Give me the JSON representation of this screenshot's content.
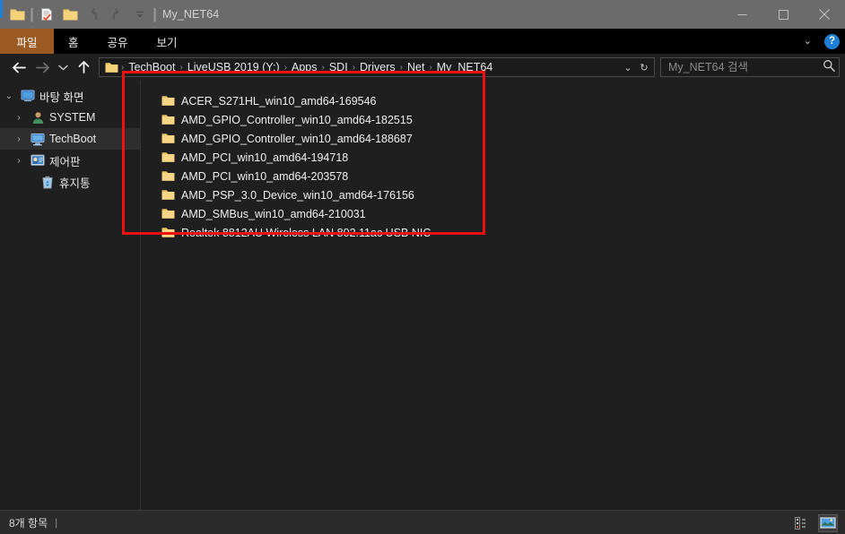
{
  "window": {
    "title": "My_NET64",
    "quick_access": [
      {
        "name": "folder-icon",
        "label": "folder"
      },
      {
        "name": "properties-icon",
        "label": "properties"
      },
      {
        "name": "new-folder-icon",
        "label": "new folder"
      },
      {
        "name": "undo-icon",
        "label": "undo"
      },
      {
        "name": "redo-icon",
        "label": "redo"
      },
      {
        "name": "customize-qat-icon",
        "label": "customize"
      }
    ],
    "controls": {
      "minimize": "—",
      "maximize": "□",
      "close": "✕"
    }
  },
  "ribbon": {
    "tabs": [
      {
        "label": "파일",
        "active": true
      },
      {
        "label": "홈",
        "active": false
      },
      {
        "label": "공유",
        "active": false
      },
      {
        "label": "보기",
        "active": false
      }
    ],
    "collapse_icon": "⌄",
    "help_label": "?"
  },
  "address": {
    "back_label": "←",
    "forward_label": "→",
    "recent_label": "⌄",
    "up_label": "↑",
    "breadcrumbs": [
      "TechBoot",
      "LiveUSB 2019 (Y:)",
      "Apps",
      "SDI",
      "Drivers",
      "Net",
      "My_NET64"
    ],
    "separator": "›",
    "dropdown_label": "⌄",
    "refresh_label": "↻"
  },
  "search": {
    "placeholder": "My_NET64 검색",
    "value": "",
    "icon": "search-icon"
  },
  "sidebar": {
    "items": [
      {
        "label": "바탕 화면",
        "icon": "desktop-icon",
        "expander": "⌄",
        "indent": 0,
        "selected": false
      },
      {
        "label": "SYSTEM",
        "icon": "user-icon",
        "expander": "›",
        "indent": 1,
        "selected": false
      },
      {
        "label": "TechBoot",
        "icon": "computer-icon",
        "expander": "›",
        "indent": 1,
        "selected": true
      },
      {
        "label": "제어판",
        "icon": "control-panel-icon",
        "expander": "›",
        "indent": 1,
        "selected": false
      },
      {
        "label": "휴지통",
        "icon": "recycle-bin-icon",
        "expander": "",
        "indent": 2,
        "selected": false
      }
    ]
  },
  "files": {
    "items": [
      {
        "name": "ACER_S271HL_win10_amd64-169546",
        "icon": "folder-icon"
      },
      {
        "name": "AMD_GPIO_Controller_win10_amd64-182515",
        "icon": "folder-icon"
      },
      {
        "name": "AMD_GPIO_Controller_win10_amd64-188687",
        "icon": "folder-icon"
      },
      {
        "name": "AMD_PCI_win10_amd64-194718",
        "icon": "folder-icon"
      },
      {
        "name": "AMD_PCI_win10_amd64-203578",
        "icon": "folder-icon"
      },
      {
        "name": "AMD_PSP_3.0_Device_win10_amd64-176156",
        "icon": "folder-icon"
      },
      {
        "name": "AMD_SMBus_win10_amd64-210031",
        "icon": "folder-icon"
      },
      {
        "name": "Realtek 8812AU Wireless LAN 802.11ac USB NIC",
        "icon": "folder-icon"
      }
    ]
  },
  "annotation": {
    "color": "#ee1111",
    "shape": "rectangle"
  },
  "statusbar": {
    "item_count_text": "8개 항목",
    "separator": "|",
    "views": [
      {
        "name": "details-view-button",
        "active": false
      },
      {
        "name": "large-icons-view-button",
        "active": true
      }
    ]
  },
  "colors": {
    "titlebar": "#6b6b6b",
    "ribbon": "#000000",
    "file_tab": "#9b5a22",
    "background": "#1f1f1f",
    "accent": "#1f7fd4",
    "annotation": "#ee1111"
  }
}
